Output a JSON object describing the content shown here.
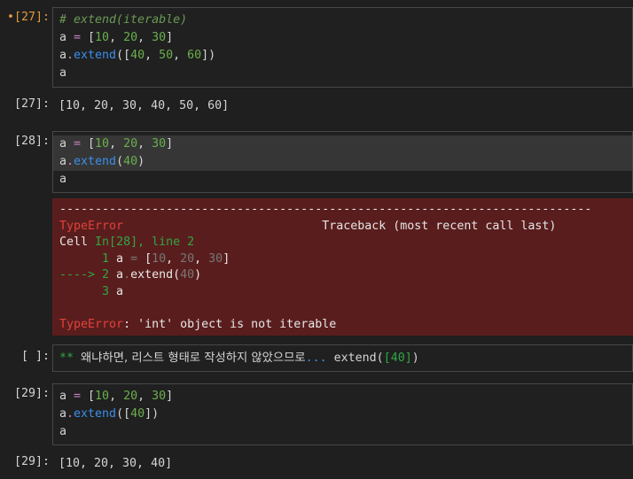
{
  "cells": [
    {
      "prompt": "•[27]:",
      "lines": [
        "# extend(iterable)",
        "a = [10, 20, 30]",
        "a.extend([40, 50, 60])",
        "a"
      ],
      "output_prompt": "[27]:",
      "output": "[10, 20, 30, 40, 50, 60]"
    },
    {
      "prompt": "[28]:",
      "lines": [
        "a = [10, 20, 30]",
        "a.extend(40)",
        "a"
      ],
      "error": {
        "dashes": "---------------------------------------------------------------------------",
        "type": "TypeError",
        "traceback_label": "Traceback (most recent call last)",
        "cell_label": "Cell",
        "cell_ref": "In[28], line 2",
        "trace_lines": [
          {
            "marker": "      1",
            "code": "a = [10, 20, 30]"
          },
          {
            "marker": "----> 2",
            "code": "a.extend(40)"
          },
          {
            "marker": "      3",
            "code": "a"
          }
        ],
        "message": ": 'int' object is not iterable"
      }
    },
    {
      "prompt": "[ ]:",
      "markdown": {
        "stars": "**",
        "text": "왜냐하면, 리스트 형태로 작성하지 않았으므로",
        "dots": "...",
        "code_fn": "extend(",
        "code_arg": "[40]",
        "code_close": ")"
      }
    },
    {
      "prompt": "[29]:",
      "lines": [
        "a = [10, 20, 30]",
        "a.extend([40])",
        "a"
      ],
      "output_prompt": "[29]:",
      "output": "[10, 20, 30, 40]"
    }
  ]
}
